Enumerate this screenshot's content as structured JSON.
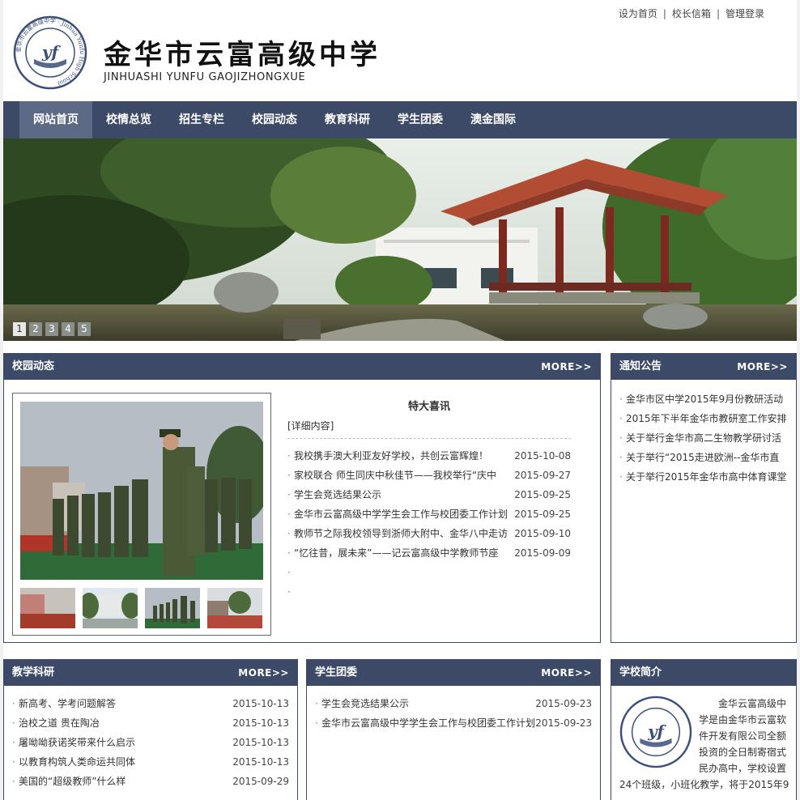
{
  "top_links": [
    "设为首页",
    "校长信箱",
    "管理登录"
  ],
  "top_sep": "|",
  "school": {
    "name_cn": "金华市云富高级中学",
    "name_en": "JINHUASHI YUNFU GAOJIZHONGXUE",
    "logo_text": "yf",
    "logo_ring_text": "金华市云富高级中学 · Jinhua Yunfu High School"
  },
  "nav": {
    "items": [
      "网站首页",
      "校情总览",
      "招生专栏",
      "校园动态",
      "教育科研",
      "学生团委",
      "澳金国际"
    ],
    "active_index": 0
  },
  "banner": {
    "pages": [
      "1",
      "2",
      "3",
      "4",
      "5"
    ],
    "active_page": 0
  },
  "campus_news": {
    "title": "校园动态",
    "more": "MORE>>",
    "headline": "特大喜讯",
    "detail": "[详细内容]",
    "items": [
      {
        "title": "我校携手澳大利亚友好学校，共创云富辉煌！",
        "date": "2015-10-08"
      },
      {
        "title": "家校联合 师生同庆中秋佳节——我校举行“庆中",
        "date": "2015-09-27"
      },
      {
        "title": "学生会竞选结果公示",
        "date": "2015-09-25"
      },
      {
        "title": "金华市云富高级中学学生会工作与校团委工作计划",
        "date": "2015-09-25"
      },
      {
        "title": "教师节之际我校领导到浙师大附中、金华八中走访",
        "date": "2015-09-10"
      },
      {
        "title": "“忆往昔，展未来”——记云富高级中学教师节座",
        "date": "2015-09-09"
      },
      {
        "title": "",
        "date": ""
      },
      {
        "title": "",
        "date": ""
      }
    ]
  },
  "notices": {
    "title": "通知公告",
    "more": "MORE>>",
    "items": [
      "金华市区中学2015年9月份教研活动",
      "2015年下半年金华市教研室工作安排",
      "关于举行金华市高二生物教学研讨活",
      "关于举行“2015走进欧洲--金华市直",
      "关于举行2015年金华市高中体育课堂"
    ]
  },
  "research": {
    "title": "教学科研",
    "more": "MORE>>",
    "items": [
      {
        "title": "新高考、学考问题解答",
        "date": "2015-10-13"
      },
      {
        "title": "治校之道 贵在陶冶",
        "date": "2015-10-13"
      },
      {
        "title": "屠呦呦获诺奖带来什么启示",
        "date": "2015-10-13"
      },
      {
        "title": "以教育构筑人类命运共同体",
        "date": "2015-10-13"
      },
      {
        "title": "美国的“超级教师”什么样",
        "date": "2015-09-29"
      }
    ]
  },
  "league": {
    "title": "学生团委",
    "more": "MORE>>",
    "items": [
      {
        "title": "学生会竞选结果公示",
        "date": "2015-09-23"
      },
      {
        "title": "金华市云富高级中学学生会工作与校团委工作计划",
        "date": "2015-09-23"
      }
    ]
  },
  "intro": {
    "title": "学校简介",
    "lines": [
      "金华云富高级中",
      "学是由金华市云富软",
      "件开发有限公司全额",
      "投资的全日制寄宿式",
      "民办高中，学校设置",
      "24个班级，小班化教学，将于2015年9"
    ]
  },
  "colors": {
    "nav_bg": "#3d4a67",
    "nav_active": "#5c6a86"
  }
}
